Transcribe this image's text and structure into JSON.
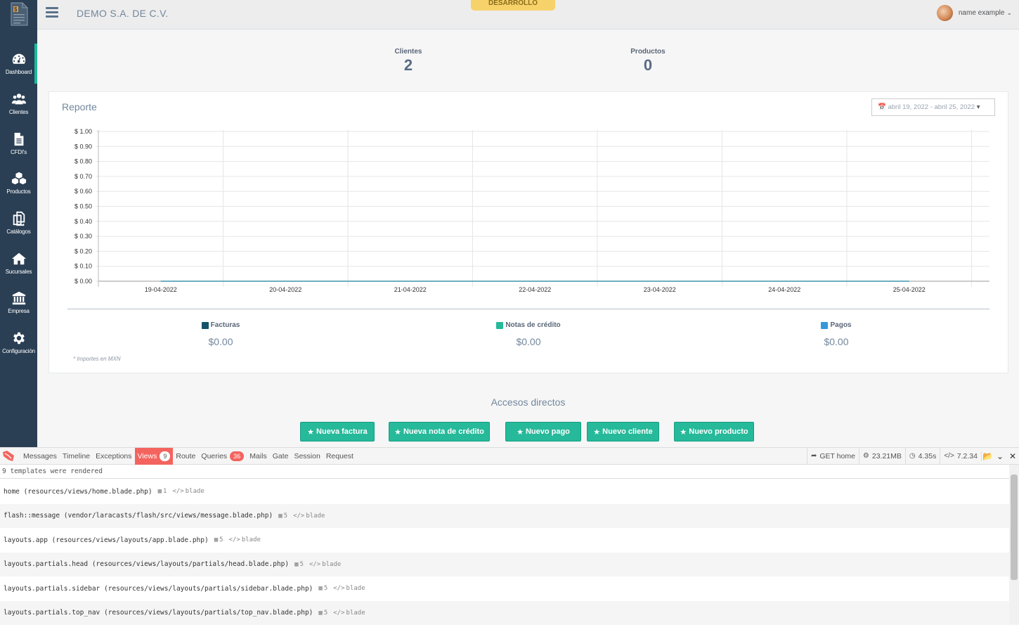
{
  "sidebar": {
    "items": [
      {
        "label": "Dashboard",
        "icon": "dashboard-icon",
        "active": true
      },
      {
        "label": "Clientes",
        "icon": "users-icon",
        "active": false
      },
      {
        "label": "CFDI's",
        "icon": "document-icon",
        "active": false
      },
      {
        "label": "Productos",
        "icon": "cubes-icon",
        "active": false
      },
      {
        "label": "Catálogos",
        "icon": "copy-icon",
        "active": false
      },
      {
        "label": "Sucursales",
        "icon": "home-icon",
        "active": false
      },
      {
        "label": "Empresa",
        "icon": "bank-icon",
        "active": false
      },
      {
        "label": "Configuración",
        "icon": "gear-icon",
        "active": false
      }
    ]
  },
  "topbar": {
    "company": "DEMO S.A. DE C.V.",
    "environment": "DESARROLLO",
    "user_name": "name example"
  },
  "stats": {
    "clientes_label": "Clientes",
    "clientes_value": "2",
    "productos_label": "Productos",
    "productos_value": "0"
  },
  "report": {
    "title": "Reporte",
    "date_range": "abril 19, 2022 - abril 25, 2022",
    "note": "* Importes en MXN",
    "legend": [
      {
        "label": "Facturas",
        "value": "$0.00",
        "color": "#145369"
      },
      {
        "label": "Notas de crédito",
        "value": "$0.00",
        "color": "#26b99a"
      },
      {
        "label": "Pagos",
        "value": "$0.00",
        "color": "#3498db"
      }
    ]
  },
  "chart_data": {
    "type": "line",
    "categories": [
      "19-04-2022",
      "20-04-2022",
      "21-04-2022",
      "22-04-2022",
      "23-04-2022",
      "24-04-2022",
      "25-04-2022"
    ],
    "series": [
      {
        "name": "Facturas",
        "values": [
          0,
          0,
          0,
          0,
          0,
          0,
          0
        ]
      },
      {
        "name": "Notas de crédito",
        "values": [
          0,
          0,
          0,
          0,
          0,
          0,
          0
        ]
      },
      {
        "name": "Pagos",
        "values": [
          0,
          0,
          0,
          0,
          0,
          0,
          0
        ]
      }
    ],
    "y_ticks": [
      "$ 0.00",
      "$ 0.10",
      "$ 0.20",
      "$ 0.30",
      "$ 0.40",
      "$ 0.50",
      "$ 0.60",
      "$ 0.70",
      "$ 0.80",
      "$ 0.90",
      "$ 1.00"
    ],
    "ylim": [
      0,
      1
    ],
    "grid": true
  },
  "accesos": {
    "title": "Accesos directos",
    "buttons": [
      "Nueva factura",
      "Nueva nota de crédito",
      "Nuevo pago",
      "Nuevo cliente",
      "Nuevo producto"
    ]
  },
  "debugbar": {
    "tabs": [
      {
        "label": "Messages"
      },
      {
        "label": "Timeline"
      },
      {
        "label": "Exceptions"
      },
      {
        "label": "Views",
        "badge": "9",
        "active": true
      },
      {
        "label": "Route"
      },
      {
        "label": "Queries",
        "badge": "36"
      },
      {
        "label": "Mails"
      },
      {
        "label": "Gate"
      },
      {
        "label": "Session"
      },
      {
        "label": "Request"
      }
    ],
    "request": "GET home",
    "memory": "23.21MB",
    "time": "4.35s",
    "php_version": "7.2.34",
    "summary": "9 templates were rendered",
    "views": [
      {
        "name": "home (resources/views/home.blade.php)",
        "params": "1",
        "type": "blade"
      },
      {
        "name": "flash::message (vendor/laracasts/flash/src/views/message.blade.php)",
        "params": "5",
        "type": "blade"
      },
      {
        "name": "layouts.app (resources/views/layouts/app.blade.php)",
        "params": "5",
        "type": "blade"
      },
      {
        "name": "layouts.partials.head (resources/views/layouts/partials/head.blade.php)",
        "params": "5",
        "type": "blade"
      },
      {
        "name": "layouts.partials.sidebar (resources/views/layouts/partials/sidebar.blade.php)",
        "params": "5",
        "type": "blade"
      },
      {
        "name": "layouts.partials.top_nav (resources/views/layouts/partials/top_nav.blade.php)",
        "params": "5",
        "type": "blade"
      }
    ]
  }
}
